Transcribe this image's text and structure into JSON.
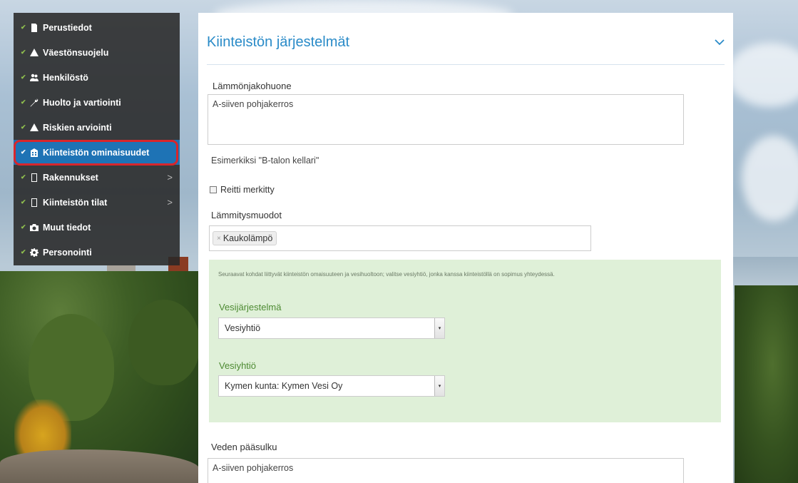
{
  "sidebar": {
    "items": [
      {
        "label": "Perustiedot",
        "icon": "document-icon",
        "checked": true,
        "has_submenu": false
      },
      {
        "label": "Väestönsuojelu",
        "icon": "warning-triangle-icon",
        "checked": true,
        "has_submenu": false
      },
      {
        "label": "Henkilöstö",
        "icon": "users-icon",
        "checked": true,
        "has_submenu": false
      },
      {
        "label": "Huolto ja vartiointi",
        "icon": "wrench-icon",
        "checked": true,
        "has_submenu": false
      },
      {
        "label": "Riskien arviointi",
        "icon": "warning-triangle-icon",
        "checked": true,
        "has_submenu": false
      },
      {
        "label": "Kiinteistön ominaisuudet",
        "icon": "building-icon",
        "checked": true,
        "has_submenu": false,
        "active": true
      },
      {
        "label": "Rakennukset",
        "icon": "doc-icon",
        "checked": true,
        "has_submenu": true
      },
      {
        "label": "Kiinteistön tilat",
        "icon": "doc-icon",
        "checked": true,
        "has_submenu": true
      },
      {
        "label": "Muut tiedot",
        "icon": "camera-icon",
        "checked": true,
        "has_submenu": false
      },
      {
        "label": "Personointi",
        "icon": "gear-icon",
        "checked": true,
        "has_submenu": false
      }
    ],
    "chevron": ">"
  },
  "panel": {
    "title": "Kiinteistön järjestelmät",
    "heat_room": {
      "label": "Lämmönjakohuone",
      "value": "A-siiven pohjakerros",
      "help": "Esimerkiksi \"B-talon kellari\""
    },
    "route_marked": {
      "label": "Reitti merkitty",
      "checked": false
    },
    "heating": {
      "label": "Lämmitysmuodot",
      "tags": [
        "Kaukolämpö"
      ],
      "tag_remove": "×"
    },
    "water": {
      "note": "Seuraavat kohdat liittyvät kiinteistön omaisuuteen ja vesihuoltoon; valitse vesiyhtiö, jonka kanssa kiinteistöllä on sopimus yhteydessä.",
      "system_label": "Vesijärjestelmä",
      "system_value": "Vesiyhtiö",
      "company_label": "Vesiyhtiö",
      "company_value": "Kymen kunta: Kymen Vesi Oy",
      "arrow": "▾"
    },
    "main_valve": {
      "label": "Veden pääsulku",
      "value": "A-siiven pohjakerros"
    }
  },
  "colors": {
    "accent": "#2a8bc8",
    "active_nav": "#1e73b5",
    "highlight": "#d9262b",
    "check": "#8fbf4e",
    "green_box": "#dff0d8"
  }
}
